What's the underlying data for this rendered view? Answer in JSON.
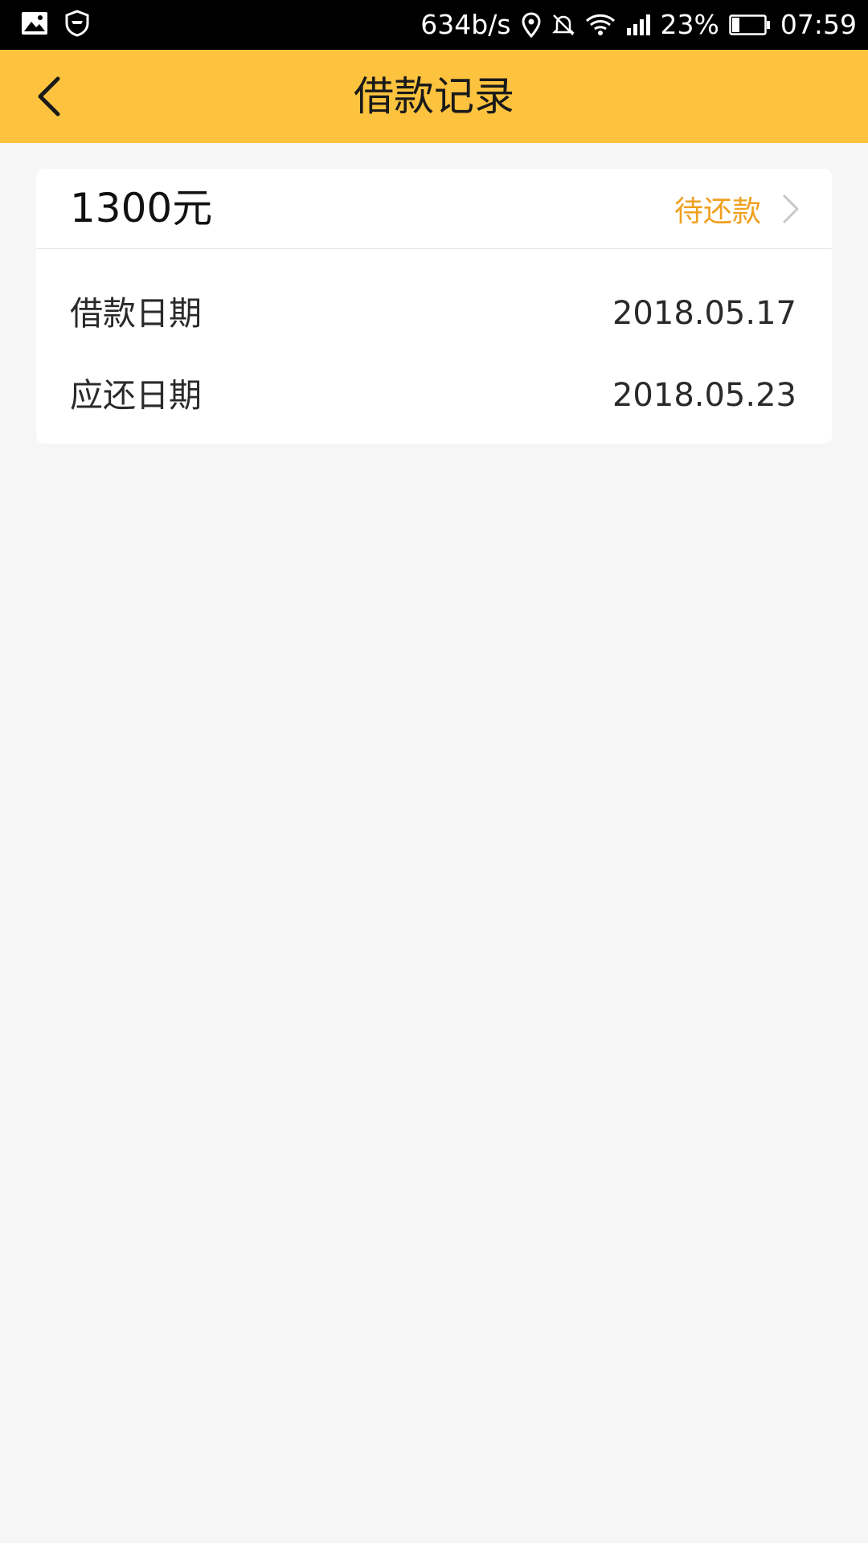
{
  "status_bar": {
    "speed": "634b/s",
    "battery": "23%",
    "time": "07:59",
    "left_icons": [
      "image-icon",
      "shield-icon"
    ],
    "right_icons": [
      "location-icon",
      "mute-icon",
      "wifi-icon",
      "signal-icon",
      "battery-icon"
    ],
    "battery_level": 0.23
  },
  "header": {
    "title": "借款记录",
    "back_icon": "chevron-left-icon",
    "background": "#fdc33f"
  },
  "record": {
    "amount": "1300元",
    "status": "待还款",
    "status_color": "#f0a020",
    "rows": [
      {
        "label": "借款日期",
        "value": "2018.05.17"
      },
      {
        "label": "应还日期",
        "value": "2018.05.23"
      }
    ]
  }
}
